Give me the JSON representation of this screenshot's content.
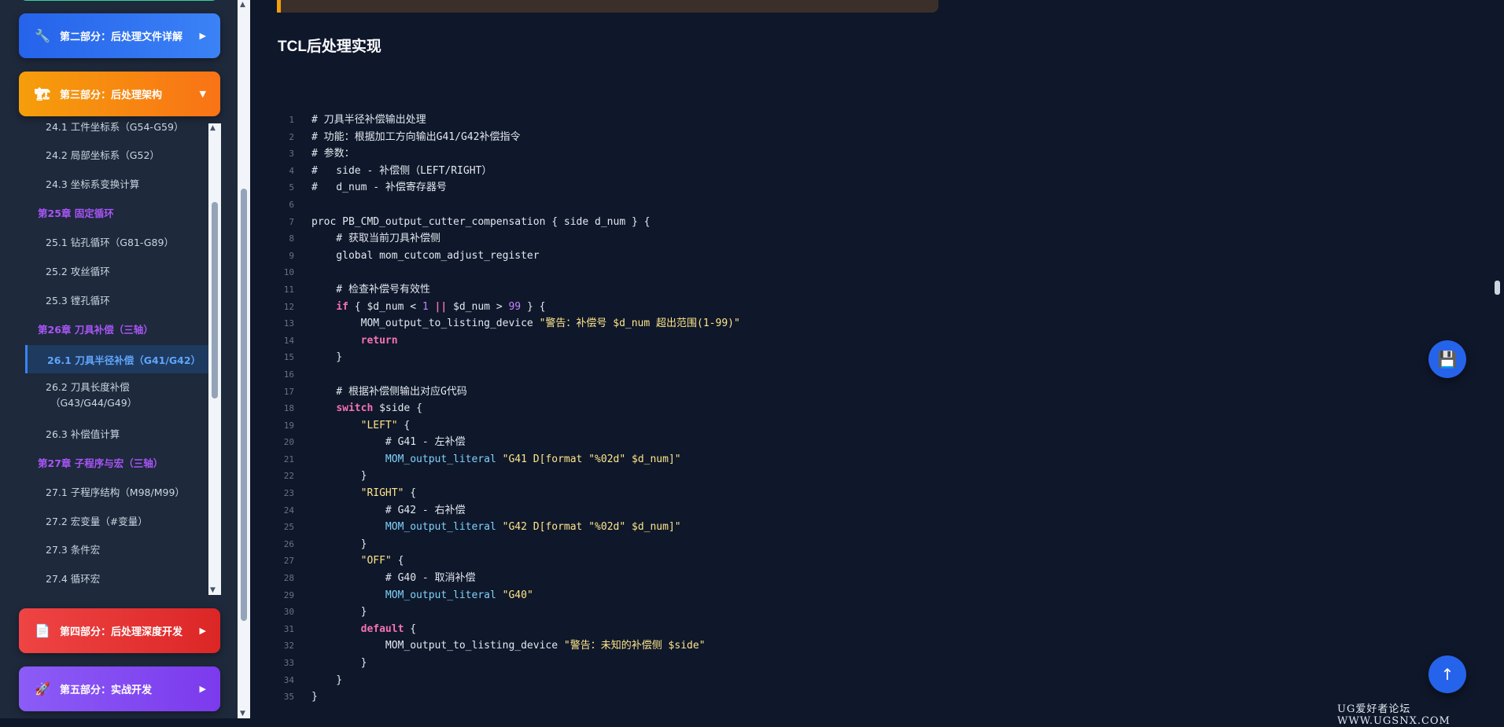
{
  "sidebar": {
    "parts": [
      {
        "label": "第二部分：后处理文件详解",
        "icon": "wrench-icon",
        "glyph": "🔧",
        "arrow": "▶"
      },
      {
        "label": "第三部分：后处理架构",
        "icon": "crane-icon",
        "glyph": "🏗",
        "arrow": "▼"
      },
      {
        "label": "第四部分：后处理深度开发",
        "icon": "document-icon",
        "glyph": "📄",
        "arrow": "▶"
      },
      {
        "label": "第五部分：实战开发",
        "icon": "rocket-icon",
        "glyph": "🚀",
        "arrow": "▶"
      }
    ],
    "toc": {
      "i241": "24.1 工件坐标系（G54-G59）",
      "i242": "24.2 局部坐标系（G52）",
      "i243": "24.3 坐标系变换计算",
      "ch25": "第25章 固定循环",
      "i251": "25.1 钻孔循环（G81-G89）",
      "i252": "25.2 攻丝循环",
      "i253": "25.3 镗孔循环",
      "ch26": "第26章 刀具补偿（三轴）",
      "i261": "26.1 刀具半径补偿（G41/G42）",
      "i262a": "26.2 刀具长度补偿",
      "i262b": "（G43/G44/G49）",
      "i263": "26.3 补偿值计算",
      "ch27": "第27章 子程序与宏（三轴）",
      "i271": "27.1 子程序结构（M98/M99）",
      "i272": "27.2 宏变量（#变量）",
      "i273": "27.3 条件宏",
      "i274": "27.4 循环宏"
    }
  },
  "main": {
    "title": "TCL后处理实现",
    "code": [
      [
        [
          "tx",
          "# 刀具半径补偿输出处理"
        ]
      ],
      [
        [
          "tx",
          "# 功能：根据加工方向输出G41/G42补偿指令"
        ]
      ],
      [
        [
          "tx",
          "# 参数："
        ]
      ],
      [
        [
          "tx",
          "#   side - 补偿侧（LEFT/RIGHT）"
        ]
      ],
      [
        [
          "tx",
          "#   d_num - 补偿寄存器号"
        ]
      ],
      [],
      [
        [
          "tx",
          "proc PB_CMD_output_cutter_compensation { side d_num } {"
        ]
      ],
      [
        [
          "tx",
          "    # 获取当前刀具补偿侧"
        ]
      ],
      [
        [
          "tx",
          "    global mom_cutcom_adjust_register"
        ]
      ],
      [],
      [
        [
          "tx",
          "    # 检查补偿号有效性"
        ]
      ],
      [
        [
          "tx",
          "    "
        ],
        [
          "kw",
          "if"
        ],
        [
          "tx",
          " { $d_num < "
        ],
        [
          "num",
          "1"
        ],
        [
          "tx",
          " "
        ],
        [
          "kw",
          "||"
        ],
        [
          "tx",
          " $d_num > "
        ],
        [
          "num",
          "99"
        ],
        [
          "tx",
          " } {"
        ]
      ],
      [
        [
          "tx",
          "        MOM_output_to_listing_device "
        ],
        [
          "str",
          "\"警告：补偿号 $d_num 超出范围(1-99)\""
        ]
      ],
      [
        [
          "tx",
          "        "
        ],
        [
          "kw",
          "return"
        ]
      ],
      [
        [
          "tx",
          "    }"
        ]
      ],
      [],
      [
        [
          "tx",
          "    # 根据补偿侧输出对应G代码"
        ]
      ],
      [
        [
          "tx",
          "    "
        ],
        [
          "kw",
          "switch"
        ],
        [
          "tx",
          " $side {"
        ]
      ],
      [
        [
          "tx",
          "        "
        ],
        [
          "str",
          "\"LEFT\""
        ],
        [
          "tx",
          " {"
        ]
      ],
      [
        [
          "tx",
          "            # G41 - 左补偿"
        ]
      ],
      [
        [
          "tx",
          "            "
        ],
        [
          "fn",
          "MOM_output_literal"
        ],
        [
          "tx",
          " "
        ],
        [
          "str",
          "\"G41 D[format \"%02d\" $d_num]\""
        ]
      ],
      [
        [
          "tx",
          "        }"
        ]
      ],
      [
        [
          "tx",
          "        "
        ],
        [
          "str",
          "\"RIGHT\""
        ],
        [
          "tx",
          " {"
        ]
      ],
      [
        [
          "tx",
          "            # G42 - 右补偿"
        ]
      ],
      [
        [
          "tx",
          "            "
        ],
        [
          "fn",
          "MOM_output_literal"
        ],
        [
          "tx",
          " "
        ],
        [
          "str",
          "\"G42 D[format \"%02d\" $d_num]\""
        ]
      ],
      [
        [
          "tx",
          "        }"
        ]
      ],
      [
        [
          "tx",
          "        "
        ],
        [
          "str",
          "\"OFF\""
        ],
        [
          "tx",
          " {"
        ]
      ],
      [
        [
          "tx",
          "            # G40 - 取消补偿"
        ]
      ],
      [
        [
          "tx",
          "            "
        ],
        [
          "fn",
          "MOM_output_literal"
        ],
        [
          "tx",
          " "
        ],
        [
          "str",
          "\"G40\""
        ]
      ],
      [
        [
          "tx",
          "        }"
        ]
      ],
      [
        [
          "tx",
          "        "
        ],
        [
          "kw",
          "default"
        ],
        [
          "tx",
          " {"
        ]
      ],
      [
        [
          "tx",
          "            MOM_output_to_listing_device "
        ],
        [
          "str",
          "\"警告：未知的补偿侧 $side\""
        ]
      ],
      [
        [
          "tx",
          "        }"
        ]
      ],
      [
        [
          "tx",
          "    }"
        ]
      ],
      [
        [
          "tx",
          "}"
        ]
      ]
    ]
  },
  "fab": {
    "save_glyph": "💾",
    "top_glyph": "↑"
  },
  "watermark": "UG爱好者论坛 WWW.UGSNX.COM",
  "colors": {
    "background": "#0f172a",
    "sidebar": "#1e293b",
    "accent": "#3b82f6",
    "chapter": "#a855f7"
  }
}
